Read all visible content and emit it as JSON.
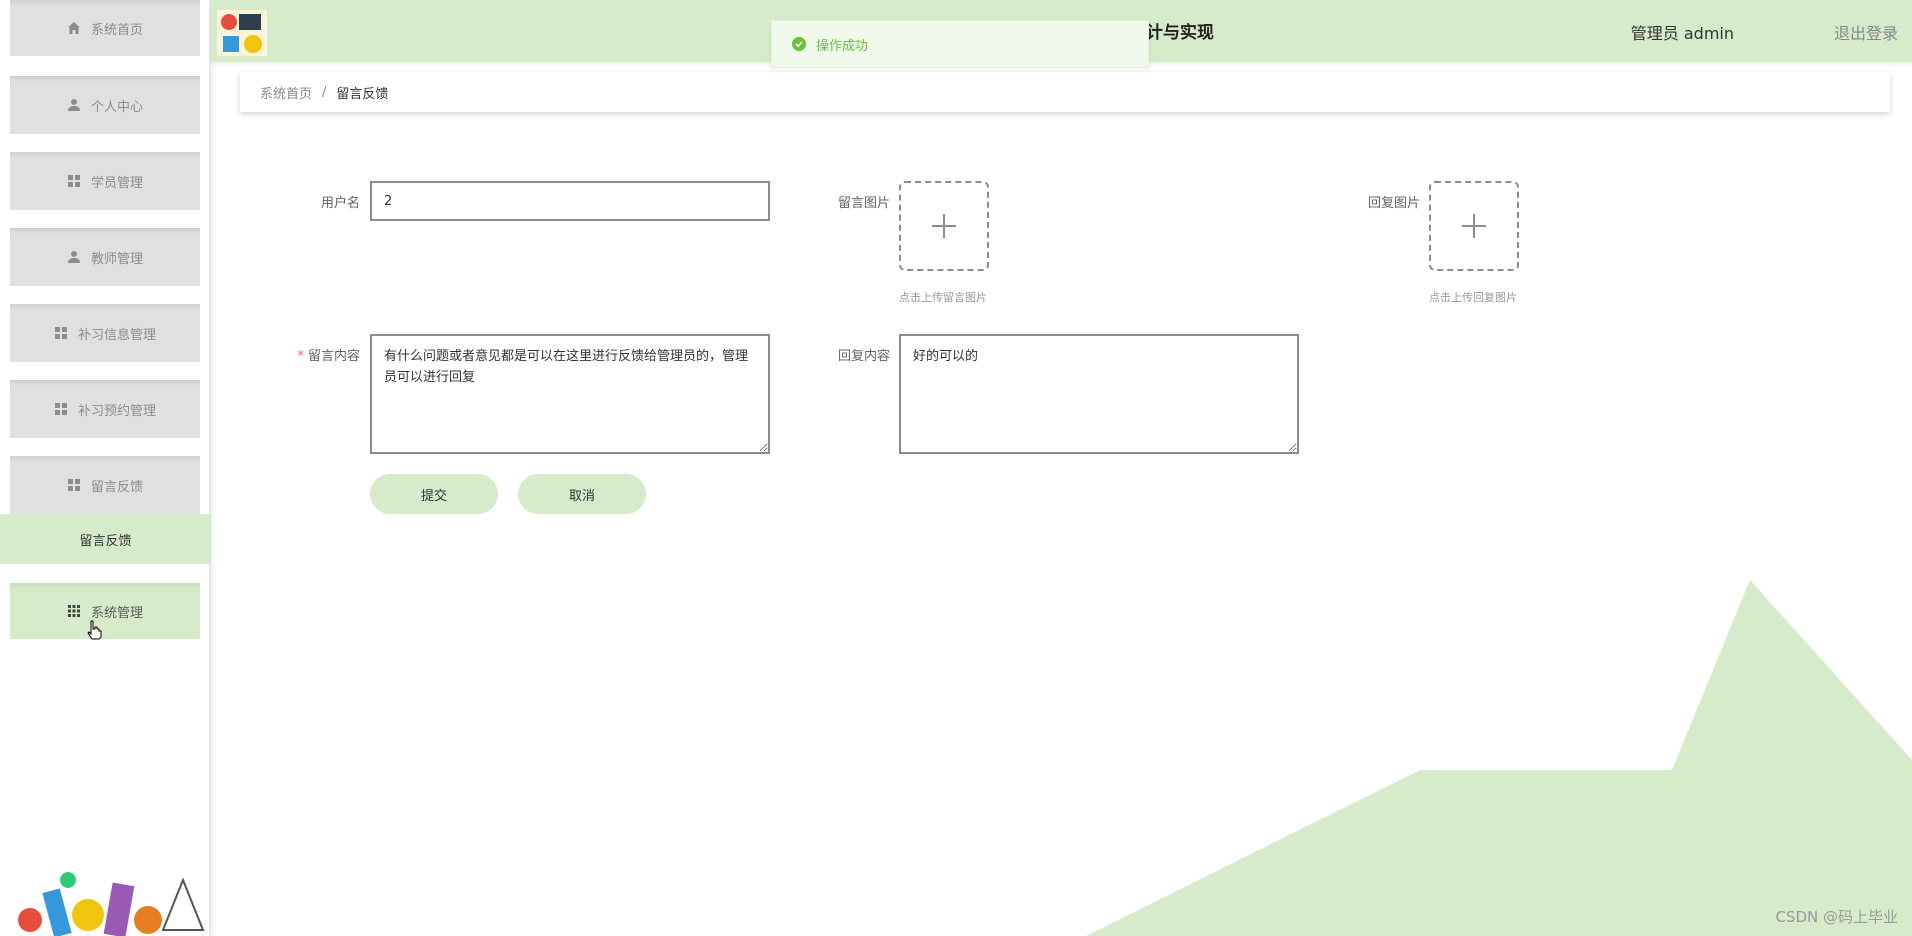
{
  "header": {
    "title": "计与实现",
    "user_label": "管理员 admin",
    "logout_label": "退出登录"
  },
  "toast": {
    "message": "操作成功"
  },
  "sidebar": {
    "items": [
      {
        "label": "系统首页",
        "icon": "home-icon"
      },
      {
        "label": "个人中心",
        "icon": "user-icon"
      },
      {
        "label": "学员管理",
        "icon": "grid-icon"
      },
      {
        "label": "教师管理",
        "icon": "user-icon"
      },
      {
        "label": "补习信息管理",
        "icon": "grid-icon"
      },
      {
        "label": "补习预约管理",
        "icon": "grid-icon"
      },
      {
        "label": "留言反馈",
        "icon": "grid-icon"
      },
      {
        "label": "系统管理",
        "icon": "apps-icon"
      }
    ],
    "submenu": {
      "label": "留言反馈"
    }
  },
  "breadcrumb": {
    "home": "系统首页",
    "separator": "/",
    "current": "留言反馈"
  },
  "form": {
    "username": {
      "label": "用户名",
      "value": "2"
    },
    "message_image": {
      "label": "留言图片",
      "tip": "点击上传留言图片"
    },
    "reply_image": {
      "label": "回复图片",
      "tip": "点击上传回复图片"
    },
    "message_content": {
      "label": "留言内容",
      "required_mark": "*",
      "value": "有什么问题或者意见都是可以在这里进行反馈给管理员的，管理员可以进行回复"
    },
    "reply_content": {
      "label": "回复内容",
      "value": "好的可以的"
    },
    "submit_label": "提交",
    "cancel_label": "取消"
  },
  "watermark": "CSDN @码上毕业",
  "colors": {
    "accent": "#d6ebc9",
    "success": "#67c23a",
    "menu_bg": "#e0e0e0"
  }
}
